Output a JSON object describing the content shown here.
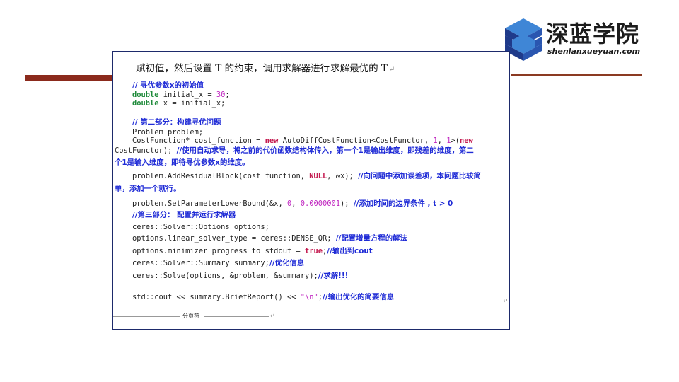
{
  "logo": {
    "title": "深蓝学院",
    "subtitle": "shenlanxueyuan.com",
    "colors": {
      "mark_dark": "#1f3a8a",
      "mark_light": "#3f86d6"
    }
  },
  "intro": {
    "text_before_cursor": "赋初值，然后设置 T 的约束，调用求解器进行",
    "text_after_cursor": "求解最优的 T",
    "para_mark": "↵"
  },
  "code": {
    "l1_comment": "// 寻优参数x的初始值",
    "l2_kw": "double",
    "l2_text": " initial_x = ",
    "l2_num": "30",
    "l2_end": ";",
    "l3_kw": "double",
    "l3_text": " x = initial_x;",
    "l4_comment": "// 第二部分：构建寻优问题",
    "l5_text": "Problem problem;",
    "l6_text": "CostFunction* cost_function = ",
    "l6_kw": "new",
    "l6_text2": " AutoDiffCostFunction<CostFunctor, ",
    "l6_num1": "1",
    "l6_sep": ", ",
    "l6_num2": "1",
    "l6_text3": ">(",
    "l6_kw2": "new",
    "l7_text": "CostFunctor); ",
    "l7_comment": "//使用自动求导，将之前的代价函数结构体传入，第一个1是输出维度，即残差的维度，第二",
    "l8_comment": "个1是输入维度，即待寻优参数x的维度。",
    "l9_text": "problem.AddResidualBlock(cost_function, ",
    "l9_kw": "NULL",
    "l9_text2": ", &x); ",
    "l9_comment": "//向问题中添加误差项，本问题比较简",
    "l10_comment": "单，添加一个就行。",
    "l11_text": "problem.SetParameterLowerBound(&x, ",
    "l11_num1": "0",
    "l11_sep": ", ",
    "l11_num2": "0.0000001",
    "l11_text2": "); ",
    "l11_comment": "//添加时间的边界条件 , t > 0",
    "l12_comment": "//第三部分： 配置并运行求解器",
    "l13_text": "ceres::Solver::Options options;",
    "l14_text": "options.linear_solver_type = ceres::DENSE_QR; ",
    "l14_comment": "//配置增量方程的解法",
    "l15_text": "options.minimizer_progress_to_stdout = ",
    "l15_kw": "true",
    "l15_end": ";",
    "l15_comment": "//输出到cout",
    "l16_text": "ceres::Solver::Summary summary;",
    "l16_comment": "//优化信息",
    "l17_text": "ceres::Solve(options, &problem, &summary);",
    "l17_comment": "//求解!!!",
    "l18_text": "std::cout << summary.BriefReport() << ",
    "l18_str": "\"\\n\"",
    "l18_end": ";",
    "l18_comment": "//输出优化的简要信息"
  },
  "page_break": {
    "label": "分页符",
    "end_mark": "↵"
  },
  "edge_mark": "↵"
}
